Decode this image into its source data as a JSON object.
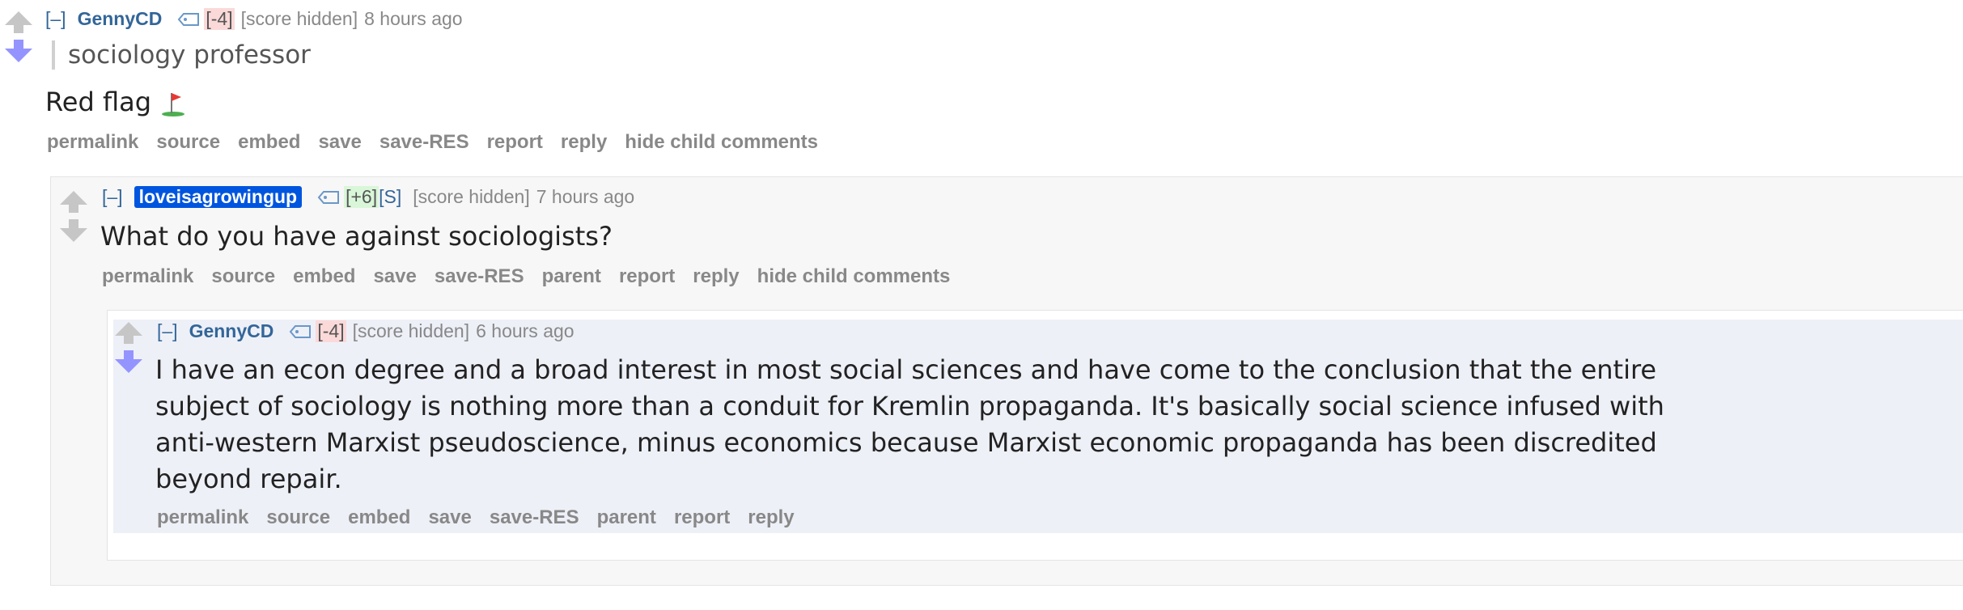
{
  "comments": [
    {
      "expand": "[–]",
      "author": "GennyCD",
      "votes": "[-4]",
      "score": "[score hidden]",
      "time": "8 hours ago",
      "flair": "sociology professor",
      "body": "Red flag",
      "buttons": [
        "permalink",
        "source",
        "embed",
        "save",
        "save-RES",
        "report",
        "reply",
        "hide child comments"
      ]
    },
    {
      "expand": "[–]",
      "author": "loveisagrowingup",
      "votes": "[+6]",
      "submitter": "[S]",
      "score": "[score hidden]",
      "time": "7 hours ago",
      "body": "What do you have against sociologists?",
      "buttons": [
        "permalink",
        "source",
        "embed",
        "save",
        "save-RES",
        "parent",
        "report",
        "reply",
        "hide child comments"
      ]
    },
    {
      "expand": "[–]",
      "author": "GennyCD",
      "votes": "[-4]",
      "score": "[score hidden]",
      "time": "6 hours ago",
      "body_lines": [
        "I have an econ degree and a broad interest in most social sciences and have come to the conclusion that the entire",
        "subject of sociology is nothing more than a conduit for Kremlin propaganda. It's basically social science infused with",
        "anti-western Marxist pseudoscience, minus economics because Marxist economic propaganda has been discredited",
        "beyond repair."
      ],
      "buttons": [
        "permalink",
        "source",
        "embed",
        "save",
        "save-RES",
        "parent",
        "report",
        "reply"
      ]
    }
  ],
  "icons": {
    "upvote": "upvote-arrow-icon",
    "downvote": "downvote-arrow-icon",
    "tag": "tag-icon",
    "flag": "golf-flag-icon"
  },
  "colors": {
    "downvote": "#9494ff",
    "op_badge": "#0055df",
    "highlight_bg": "#eef0f8",
    "child_bg": "#f7f7f7"
  }
}
